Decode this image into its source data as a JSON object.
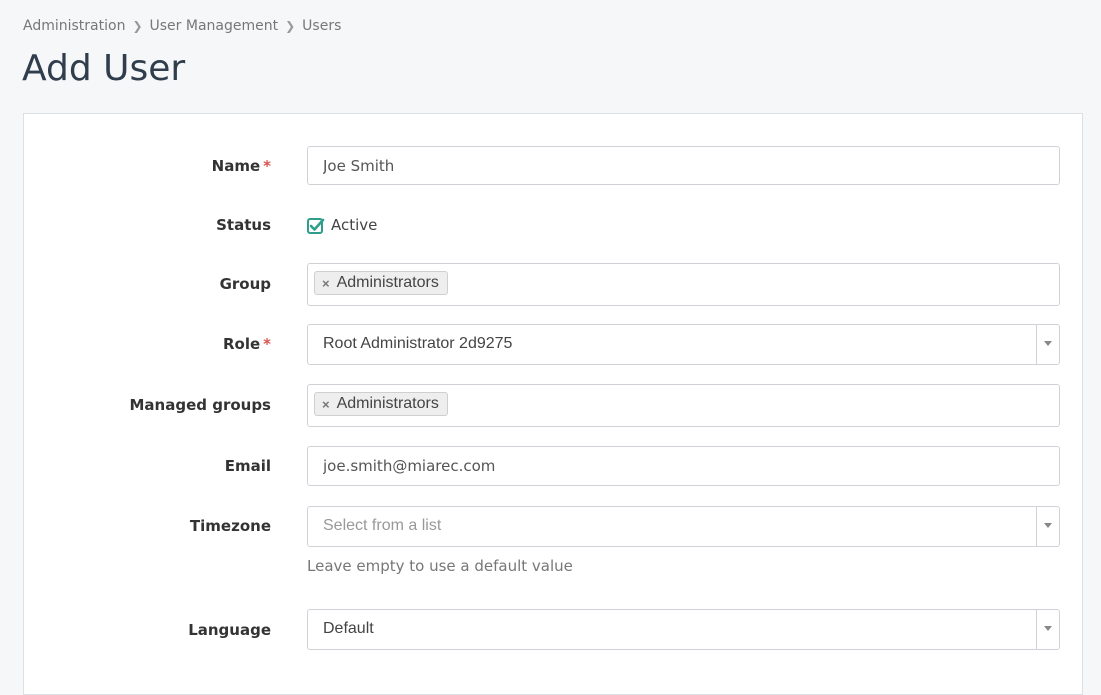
{
  "breadcrumb": {
    "items": [
      "Administration",
      "User Management",
      "Users"
    ]
  },
  "page": {
    "title": "Add User"
  },
  "form": {
    "name": {
      "label": "Name",
      "required": "*",
      "value": "Joe Smith"
    },
    "status": {
      "label": "Status",
      "checkbox_label": "Active",
      "checked": true
    },
    "group": {
      "label": "Group",
      "tags": [
        "Administrators"
      ],
      "remove_glyph": "×"
    },
    "role": {
      "label": "Role",
      "required": "*",
      "value": "Root Administrator 2d9275"
    },
    "managed_groups": {
      "label": "Managed groups",
      "tags": [
        "Administrators"
      ],
      "remove_glyph": "×"
    },
    "email": {
      "label": "Email",
      "value": "joe.smith@miarec.com"
    },
    "timezone": {
      "label": "Timezone",
      "placeholder": "Select from a list",
      "help": "Leave empty to use a default value"
    },
    "language": {
      "label": "Language",
      "value": "Default"
    }
  },
  "colors": {
    "accent": "#2f9e8a",
    "required": "#d9534f",
    "title": "#2f3d4d"
  },
  "icons": {
    "breadcrumb_separator": "chevron-right-icon",
    "checkbox": "checkbox-checked-icon",
    "tag_remove": "close-icon",
    "dropdown": "chevron-down-icon"
  }
}
